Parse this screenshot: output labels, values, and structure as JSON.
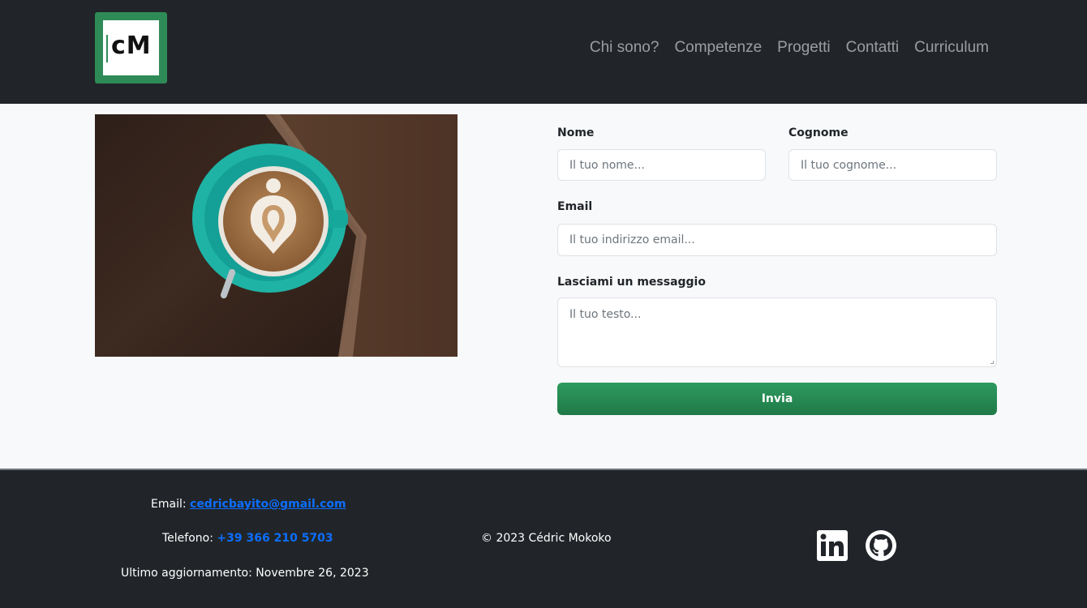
{
  "header": {
    "logo_text": "cM",
    "nav": [
      "Chi sono?",
      "Competenze",
      "Progetti",
      "Contatti",
      "Curriculum"
    ]
  },
  "form": {
    "nome_label": "Nome",
    "nome_placeholder": "Il tuo nome...",
    "cognome_label": "Cognome",
    "cognome_placeholder": "Il tuo cognome...",
    "email_label": "Email",
    "email_placeholder": "Il tuo indirizzo email...",
    "message_label": "Lasciami un messaggio",
    "message_placeholder": "Il tuo testo...",
    "submit_label": "Invia"
  },
  "footer": {
    "email_label": "Email:",
    "email_value": "cedricbayito@gmail.com",
    "phone_label": "Telefono:",
    "phone_value": "+39 366 210 5703",
    "updated": "Ultimo aggiornamento: Novembre 26, 2023",
    "copyright": "© 2023 Cédric Mokoko"
  },
  "colors": {
    "dark": "#212529",
    "accent_green": "#2e8b57",
    "link_blue": "#0d6efd",
    "background": "#f8f9fa"
  },
  "icons": [
    "linkedin-icon",
    "github-icon"
  ]
}
